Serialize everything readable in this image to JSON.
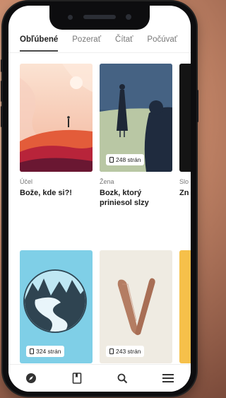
{
  "tabs": [
    {
      "label": "Obľúbené",
      "active": true
    },
    {
      "label": "Pozerať"
    },
    {
      "label": "Čítať"
    },
    {
      "label": "Počúvať"
    }
  ],
  "books": [
    {
      "category": "Účel",
      "title": "Bože, kde si?!",
      "pages": ""
    },
    {
      "category": "Žena",
      "title": "Bozk, ktorý priniesol slzy",
      "pages": "248 strán"
    },
    {
      "category": "Slo",
      "title": "Zn",
      "pages": ""
    },
    {
      "category": "",
      "title": "",
      "pages": "324 strán"
    },
    {
      "category": "",
      "title": "",
      "pages": "243 strán"
    }
  ],
  "bottom_nav": [
    "compass-icon",
    "bookmark-icon",
    "search-icon",
    "menu-icon"
  ]
}
